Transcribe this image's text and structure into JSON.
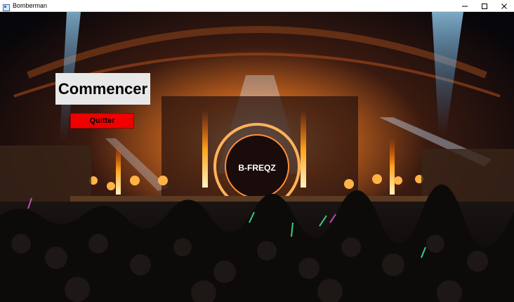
{
  "window": {
    "title": "Bomberman"
  },
  "menu": {
    "start_label": "Commencer",
    "quit_label": "Quitter"
  },
  "scene": {
    "stage_sign": "B-FREQZ"
  },
  "colors": {
    "start_bg": "#e8e8e8",
    "quit_bg": "#f00000",
    "titlebar_bg": "#ffffff"
  },
  "icons": [
    "app-icon",
    "minimize-icon",
    "maximize-icon",
    "close-icon"
  ]
}
